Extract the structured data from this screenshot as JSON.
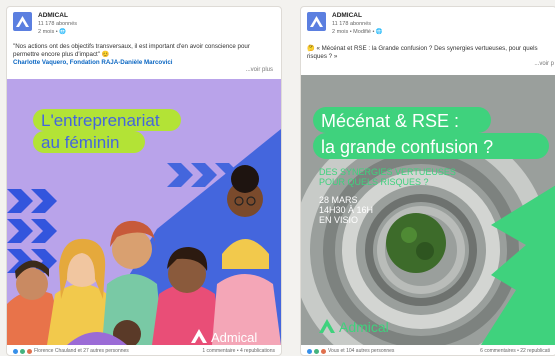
{
  "post1": {
    "org": "ADMICAL",
    "followers": "11 178 abonnés",
    "time": "2 mois • 🌐",
    "quote": "\"Nos actions ont des objectifs transversaux, il est important d'en avoir conscience pour permettre encore plus d'impact\"",
    "authors": "Charlotte Vaquero, Fondation RAJA-Danièle Marcovici",
    "see_more": "...voir plus",
    "title_line1": "L'entreprenariat",
    "title_line2": "au féminin",
    "brand": "Admical",
    "reactions": "Florence Chauland et 27 autres personnes",
    "stats": "1 commentaire • 4 republications"
  },
  "post2": {
    "org": "ADMICAL",
    "followers": "11 178 abonnés",
    "time": "2 mois • Modifié • 🌐",
    "text": "« Mécénat et RSE : la Grande confusion ? Des synergies vertueuses, pour quels risques ? »",
    "see_more": "...voir p",
    "title_line1": "Mécénat & RSE :",
    "title_line2": "la grande confusion ?",
    "subtitle_line1": "DES SYNERGIES VERTUEUSES",
    "subtitle_line2": "POUR QUELS RISQUES ?",
    "date_line1": "28 MARS",
    "date_line2": "14H30 À 16H",
    "date_line3": "EN VISIO",
    "brand": "Admical",
    "reactions": "Vous et 104 autres personnes",
    "stats": "6 commentaires • 22 republicati"
  },
  "colors": {
    "purple": "#b9a3ea",
    "lime": "#b3e336",
    "blue": "#4466dd",
    "green": "#3fd27d",
    "link": "#0a66c2"
  }
}
